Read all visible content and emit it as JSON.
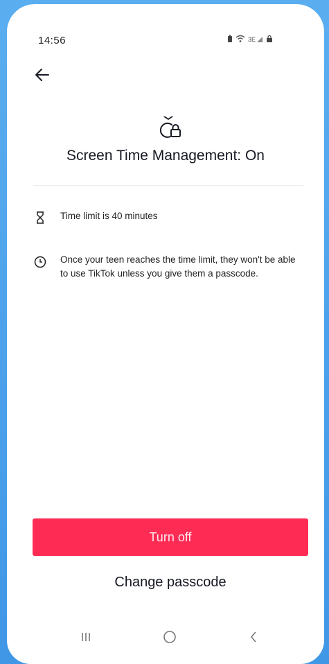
{
  "status_bar": {
    "time": "14:56",
    "icons": [
      "battery-icon",
      "wifi-icon",
      "signal-icon",
      "lock-icon"
    ]
  },
  "header": {
    "back_icon": "arrow-left-icon"
  },
  "hero": {
    "icon": "timer-lock-icon",
    "title": "Screen Time Management: On"
  },
  "info": {
    "limit": {
      "icon": "hourglass-icon",
      "text": "Time limit is 40 minutes"
    },
    "description": {
      "icon": "clock-icon",
      "text": "Once your teen reaches the time limit, they won't be able to use TikTok unless you give them a passcode."
    }
  },
  "actions": {
    "turn_off_label": "Turn off",
    "change_passcode_label": "Change passcode"
  },
  "nav_bar": {
    "recents_icon": "recents-icon",
    "home_icon": "home-circle-icon",
    "back_icon": "back-chevron-icon"
  },
  "colors": {
    "accent": "#fe2c55",
    "text": "#161823",
    "background_frame": "#4aa3ec"
  }
}
